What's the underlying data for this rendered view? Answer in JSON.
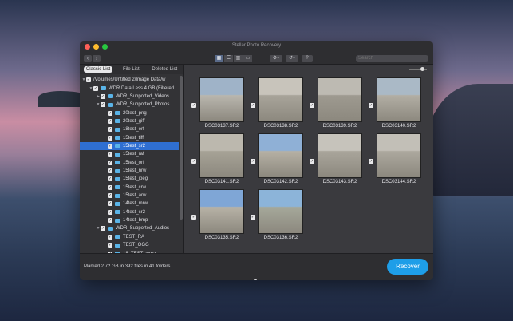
{
  "window": {
    "title": "Stellar Photo Recovery",
    "traffic_lights": [
      "#fe5f57",
      "#febc2e",
      "#28c840"
    ]
  },
  "toolbar": {
    "back_icon": "chevron-left-icon",
    "back_glyph": "‹",
    "forward_icon": "chevron-right-icon",
    "forward_glyph": "›",
    "view_modes": [
      {
        "icon": "grid-view-icon",
        "glyph": "▦"
      },
      {
        "icon": "list-view-icon",
        "glyph": "☰"
      },
      {
        "icon": "column-view-icon",
        "glyph": "▥"
      },
      {
        "icon": "coverflow-view-icon",
        "glyph": "▭"
      }
    ],
    "settings_glyph": "⚙▾",
    "history_glyph": "↺▾",
    "help_label": "?",
    "search_placeholder": "Search"
  },
  "sidebar": {
    "tabs": [
      "Classic List",
      "File List",
      "Deleted List"
    ],
    "active_tab": "Classic List",
    "tree": [
      {
        "label": "/Volumes/Untitled 2/Image Data/w",
        "indent": 0,
        "expand": "▼",
        "folder": false
      },
      {
        "label": "WDR Data Less 4 GB (Filtered",
        "indent": 1,
        "expand": "▼",
        "folder": true
      },
      {
        "label": "WDR_Supported_Videos",
        "indent": 2,
        "expand": "▶",
        "folder": true
      },
      {
        "label": "WDR_Supported_Photos",
        "indent": 2,
        "expand": "▼",
        "folder": true
      },
      {
        "label": "20test_png",
        "indent": 3,
        "expand": "",
        "folder": true
      },
      {
        "label": "20test_giff",
        "indent": 3,
        "expand": "",
        "folder": true
      },
      {
        "label": "18test_erf",
        "indent": 3,
        "expand": "",
        "folder": true
      },
      {
        "label": "15test_tiff",
        "indent": 3,
        "expand": "",
        "folder": true
      },
      {
        "label": "15test_sr2",
        "indent": 3,
        "expand": "",
        "folder": true,
        "selected": true
      },
      {
        "label": "15test_raf",
        "indent": 3,
        "expand": "",
        "folder": true
      },
      {
        "label": "15test_orf",
        "indent": 3,
        "expand": "",
        "folder": true
      },
      {
        "label": "15test_nrw",
        "indent": 3,
        "expand": "",
        "folder": true
      },
      {
        "label": "15test_jpeg",
        "indent": 3,
        "expand": "",
        "folder": true
      },
      {
        "label": "15test_crw",
        "indent": 3,
        "expand": "",
        "folder": true
      },
      {
        "label": "15test_arw",
        "indent": 3,
        "expand": "",
        "folder": true
      },
      {
        "label": "14test_mrw",
        "indent": 3,
        "expand": "",
        "folder": true
      },
      {
        "label": "14test_cr2",
        "indent": 3,
        "expand": "",
        "folder": true
      },
      {
        "label": "14test_bmp",
        "indent": 3,
        "expand": "",
        "folder": true
      },
      {
        "label": "WDR_Supported_Audios",
        "indent": 2,
        "expand": "▼",
        "folder": true
      },
      {
        "label": "TEST_RA",
        "indent": 3,
        "expand": "",
        "folder": true
      },
      {
        "label": "TEST_OGG",
        "indent": 3,
        "expand": "",
        "folder": true
      },
      {
        "label": "18_TEST_wma",
        "indent": 3,
        "expand": "",
        "folder": true
      }
    ]
  },
  "grid": {
    "files": [
      {
        "name": "DSC03137.SR2",
        "sky": "#9fb3c8",
        "ground": "#b9b6ae"
      },
      {
        "name": "DSC03138.SR2",
        "sky": "#c8c4bb",
        "ground": "#a8a49a"
      },
      {
        "name": "DSC03139.SR2",
        "sky": "#bdbab2",
        "ground": "#9e9a90"
      },
      {
        "name": "DSC03140.SR2",
        "sky": "#aab9c6",
        "ground": "#b2aea4"
      },
      {
        "name": "DSC03141.SR2",
        "sky": "#bcb8ae",
        "ground": "#a6a296"
      },
      {
        "name": "DSC03142.SR2",
        "sky": "#8fb0d6",
        "ground": "#b5b0a4"
      },
      {
        "name": "DSC03143.SR2",
        "sky": "#c6c3bb",
        "ground": "#a9a59b"
      },
      {
        "name": "DSC03144.SR2",
        "sky": "#c2bfb7",
        "ground": "#aca89e"
      },
      {
        "name": "DSC03135.SR2",
        "sky": "#7fa6d6",
        "ground": "#b7b2a6"
      },
      {
        "name": "DSC03136.SR2",
        "sky": "#8cb4d9",
        "ground": "#a5a89a"
      }
    ]
  },
  "footer": {
    "status": "Marked 2.72 GB in 392 files in 41 folders",
    "recover_label": "Recover"
  },
  "colors": {
    "accent": "#1e9ee8",
    "selection": "#2f6fd1",
    "folder": "#5ab4e8"
  }
}
